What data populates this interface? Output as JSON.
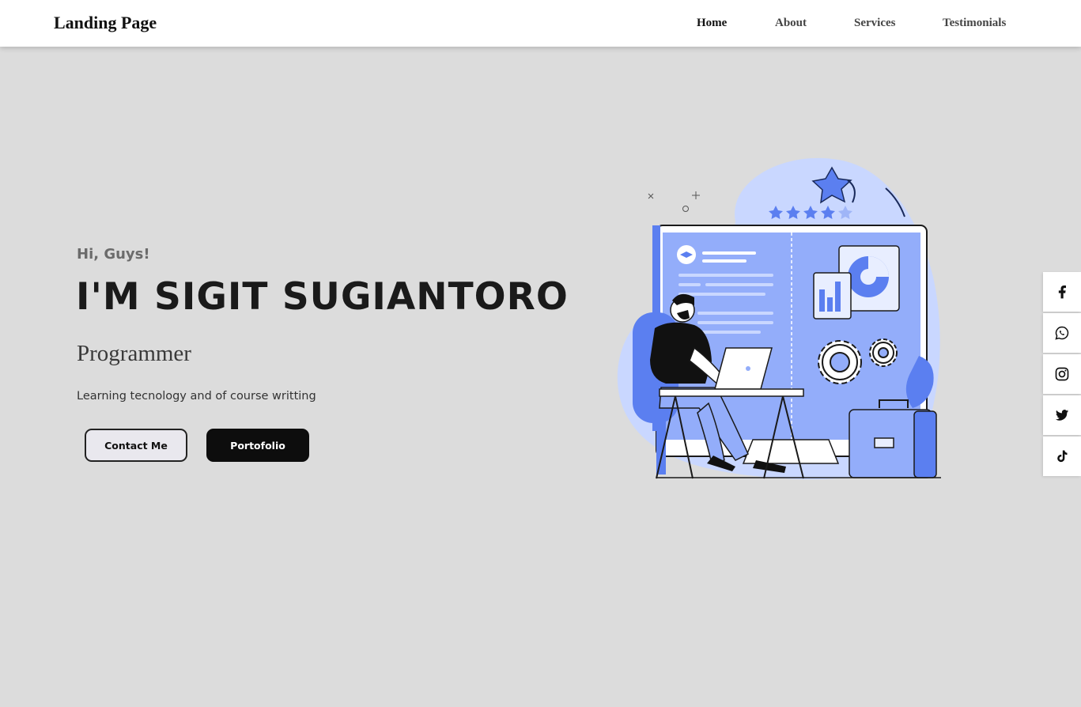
{
  "header": {
    "brand": "Landing Page",
    "nav": [
      {
        "label": "Home",
        "active": true
      },
      {
        "label": "About",
        "active": false
      },
      {
        "label": "Services",
        "active": false
      },
      {
        "label": "Testimonials",
        "active": false
      }
    ]
  },
  "hero": {
    "greeting": "Hi, Guys!",
    "name": "I'M SIGIT SUGIANTORO",
    "role": "Programmer",
    "description": "Learning tecnology and of course writting",
    "buttons": {
      "contact": "Contact Me",
      "portfolio": "Portofolio"
    }
  },
  "social": [
    {
      "icon": "facebook-icon"
    },
    {
      "icon": "whatsapp-icon"
    },
    {
      "icon": "instagram-icon"
    },
    {
      "icon": "twitter-icon"
    },
    {
      "icon": "tiktok-icon"
    }
  ],
  "colors": {
    "background": "#dcdcdc",
    "accent": "#5b7ff0",
    "accent_light": "#c9d7ff",
    "dark": "#0d0d0d"
  }
}
